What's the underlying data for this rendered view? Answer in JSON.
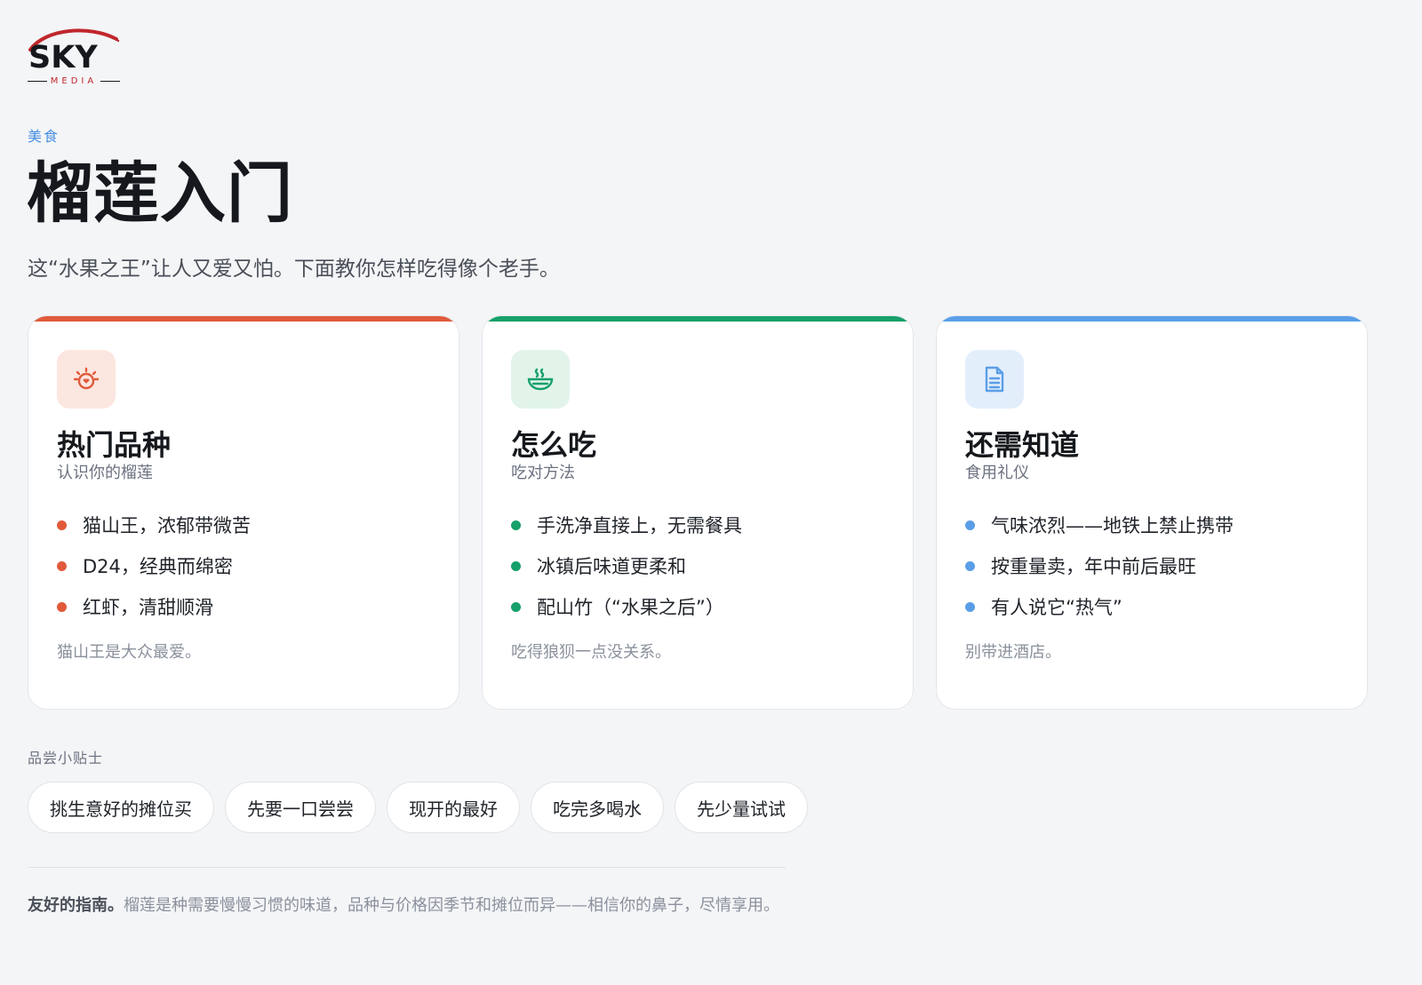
{
  "brand": {
    "name": "SKY",
    "tagline": "MEDIA",
    "accent": "#c0272d"
  },
  "header": {
    "category": "美食",
    "title": "榴莲入门",
    "subtitle": "这“水果之王”让人又爱又怕。下面教你怎样吃得像个老手。"
  },
  "cards": [
    {
      "icon": "durian-icon",
      "accent": "#e05a3a",
      "icon_bg": "#fce6e0",
      "title": "热门品种",
      "subtitle": "认识你的榴莲",
      "items": [
        "猫山王，浓郁带微苦",
        "D24，经典而绵密",
        "红虾，清甜顺滑"
      ],
      "note": "猫山王是大众最爱。"
    },
    {
      "icon": "bowl-icon",
      "accent": "#16a06a",
      "icon_bg": "#e2f4ea",
      "title": "怎么吃",
      "subtitle": "吃对方法",
      "items": [
        "手洗净直接上，无需餐具",
        "冰镇后味道更柔和",
        "配山竹（“水果之后”）"
      ],
      "note": "吃得狼狈一点没关系。"
    },
    {
      "icon": "document-icon",
      "accent": "#5a9ee8",
      "icon_bg": "#e3eefb",
      "title": "还需知道",
      "subtitle": "食用礼仪",
      "items": [
        "气味浓烈——地铁上禁止携带",
        "按重量卖，年中前后最旺",
        "有人说它“热气”"
      ],
      "note": "别带进酒店。"
    }
  ],
  "tips": {
    "label": "品尝小贴士",
    "chips": [
      "挑生意好的摊位买",
      "先要一口尝尝",
      "现开的最好",
      "吃完多喝水",
      "先少量试试"
    ]
  },
  "footer": {
    "lead": "友好的指南。",
    "text": "榴莲是种需要慢慢习惯的味道，品种与价格因季节和摊位而异——相信你的鼻子，尽情享用。"
  }
}
